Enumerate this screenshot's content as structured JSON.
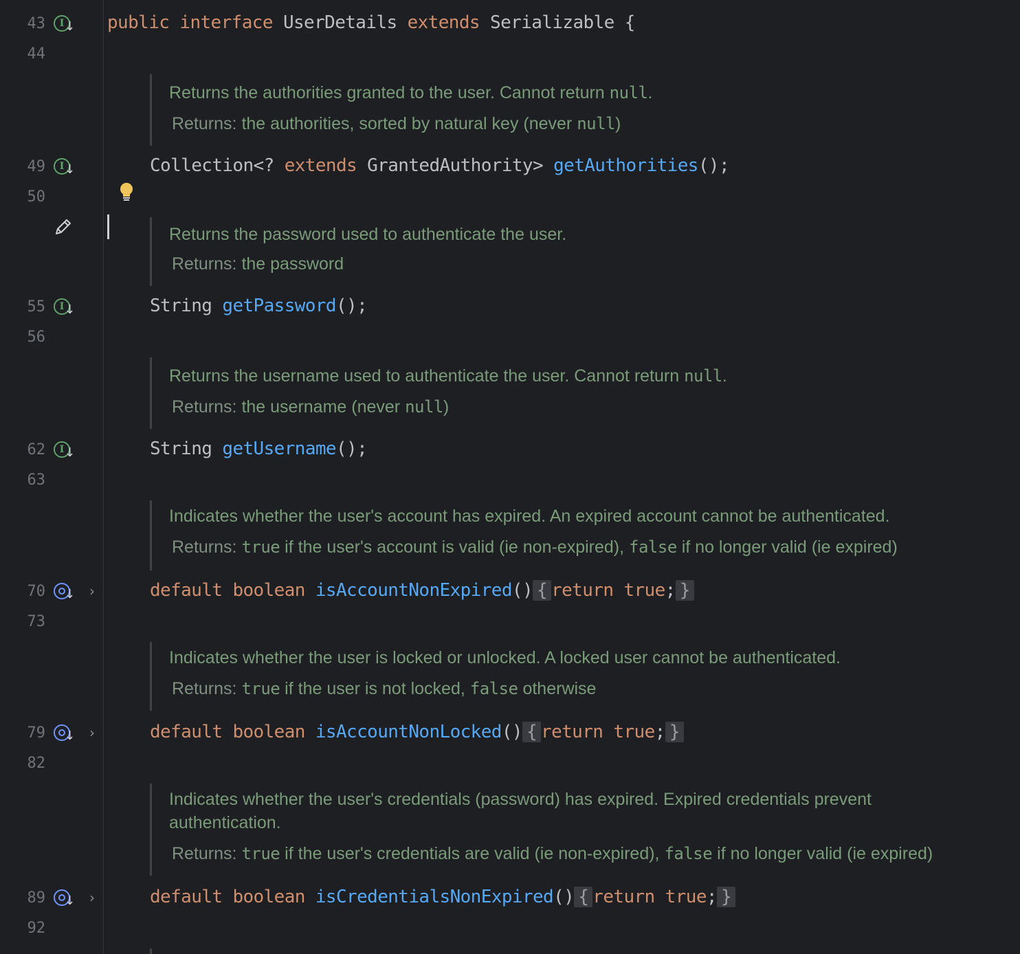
{
  "editor": {
    "line_numbers": {
      "l43": "43",
      "l44": "44",
      "l49": "49",
      "l50": "50",
      "l55": "55",
      "l56": "56",
      "l62": "62",
      "l63": "63",
      "l70": "70",
      "l73": "73",
      "l79": "79",
      "l82": "82",
      "l89": "89",
      "l92": "92"
    },
    "code": {
      "l43": {
        "kw1": "public",
        "kw2": "interface",
        "name": "UserDetails",
        "kw3": "extends",
        "rest": "Serializable {"
      },
      "l49": {
        "pre": "Collection<? ",
        "kw": "extends",
        "mid": " GrantedAuthority> ",
        "fn": "getAuthorities",
        "post": "();"
      },
      "l55": {
        "type": "String",
        "fn": "getPassword",
        "post": "();"
      },
      "l62": {
        "type": "String",
        "fn": "getUsername",
        "post": "();"
      },
      "l70": {
        "kw1": "default",
        "kw2": "boolean",
        "fn": "isAccountNonExpired",
        "parens": "()",
        "open": "{",
        "ret": "return",
        "val": "true",
        "semi": ";",
        "close": "}"
      },
      "l79": {
        "kw1": "default",
        "kw2": "boolean",
        "fn": "isAccountNonLocked",
        "parens": "()",
        "open": "{",
        "ret": "return",
        "val": "true",
        "semi": ";",
        "close": "}"
      },
      "l89": {
        "kw1": "default",
        "kw2": "boolean",
        "fn": "isCredentialsNonExpired",
        "parens": "()",
        "open": "{",
        "ret": "return",
        "val": "true",
        "semi": ";",
        "close": "}"
      }
    },
    "docs": {
      "authorities": {
        "desc": "Returns the authorities granted to the user. Cannot return ",
        "desc_code": "null",
        "desc_end": ".",
        "returns_label": "Returns:",
        "returns": "the authorities, sorted by natural key (never ",
        "returns_code": "null",
        "returns_end": ")"
      },
      "password": {
        "desc": "Returns the password used to authenticate the user.",
        "returns_label": "Returns:",
        "returns": "the password"
      },
      "username": {
        "desc": "Returns the username used to authenticate the user. Cannot return ",
        "desc_code": "null",
        "desc_end": ".",
        "returns_label": "Returns:",
        "returns": "the username (never ",
        "returns_code": "null",
        "returns_end": ")"
      },
      "expired": {
        "desc": "Indicates whether the user's account has expired. An expired account cannot be authenticated.",
        "returns_label": "Returns:",
        "r_code1": "true",
        "r_text1": " if the user's account is valid (ie non-expired), ",
        "r_code2": "false",
        "r_text2": " if no longer valid (ie expired)"
      },
      "locked": {
        "desc": "Indicates whether the user is locked or unlocked. A locked user cannot be authenticated.",
        "returns_label": "Returns:",
        "r_code1": "true",
        "r_text1": " if the user is not locked, ",
        "r_code2": "false",
        "r_text2": " otherwise"
      },
      "credentials": {
        "desc": "Indicates whether the user's credentials (password) has expired. Expired credentials prevent authentication.",
        "returns_label": "Returns:",
        "r_code1": "true",
        "r_text1": " if the user's credentials are valid (ie non-expired), ",
        "r_code2": "false",
        "r_text2": " if no longer valid (ie expired)"
      }
    },
    "gutter_icons": {
      "implemented": "implemented-in-subclass-icon",
      "overridden": "overridden-in-subclass-icon",
      "fold": "chevron-right-icon",
      "edit": "pencil-icon",
      "intention": "lightbulb-icon"
    },
    "colors": {
      "background": "#1e1f22",
      "keyword": "#cf8e6d",
      "function": "#56a8f5",
      "doc_text": "#7a9b79",
      "implemented_icon": "#5fa36a",
      "overridden_icon": "#6f94ff"
    }
  }
}
